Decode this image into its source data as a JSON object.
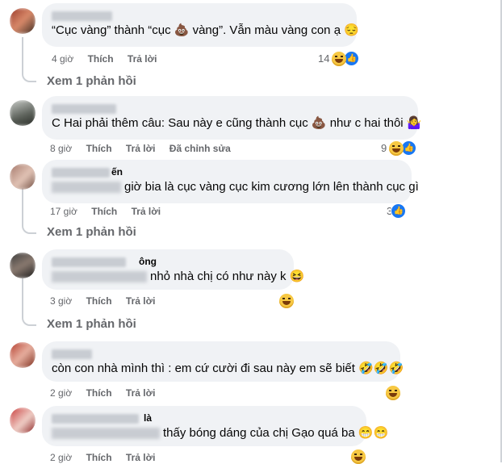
{
  "comments": [
    {
      "name_suffix": "",
      "text": "“Cục vàng” thành “cục 💩 vàng”. Vẫn màu vàng con ạ 😔",
      "time": "4 giờ",
      "like": "Thích",
      "reply": "Trả lời",
      "edited": "",
      "reaction_count": "14",
      "view_replies": "Xem 1 phản hồi"
    },
    {
      "name_suffix": "",
      "text": "C Hai phải thêm câu: Sau này e cũng thành cục 💩 như c hai thôi 🤷‍♀️",
      "time": "8 giờ",
      "like": "Thích",
      "reply": "Trả lời",
      "edited": "Đã chỉnh sửa",
      "reaction_count": "9",
      "view_replies": ""
    },
    {
      "name_suffix": "ến",
      "text": "giờ bia là cục vàng cục kim cương lớn lên thành cục gì",
      "time": "17 giờ",
      "like": "Thích",
      "reply": "Trả lời",
      "edited": "",
      "reaction_count": "3",
      "view_replies": "Xem 1 phản hồi"
    },
    {
      "name_suffix": "ông",
      "text": "nhỏ nhà chị có như này k 😆",
      "time": "3 giờ",
      "like": "Thích",
      "reply": "Trả lời",
      "edited": "",
      "reaction_count": "",
      "view_replies": "Xem 1 phản hồi"
    },
    {
      "name_suffix": "",
      "text": "còn con nhà mình thì : em cứ cười đi sau này em sẽ biết 🤣🤣🤣",
      "time": "2 giờ",
      "like": "Thích",
      "reply": "Trả lời",
      "edited": "",
      "reaction_count": "",
      "view_replies": ""
    },
    {
      "name_suffix": "là",
      "text": "thấy bóng dáng của chị Gạo quá ba 😁😁",
      "time": "2 giờ",
      "like": "Thích",
      "reply": "Trả lời",
      "edited": "",
      "reaction_count": "",
      "view_replies": ""
    }
  ],
  "colors": {
    "bubble": "#f0f2f5",
    "meta": "#65676b",
    "like_blue": "#1877f2"
  },
  "icons": [
    "haha-reaction-icon",
    "like-reaction-icon"
  ]
}
